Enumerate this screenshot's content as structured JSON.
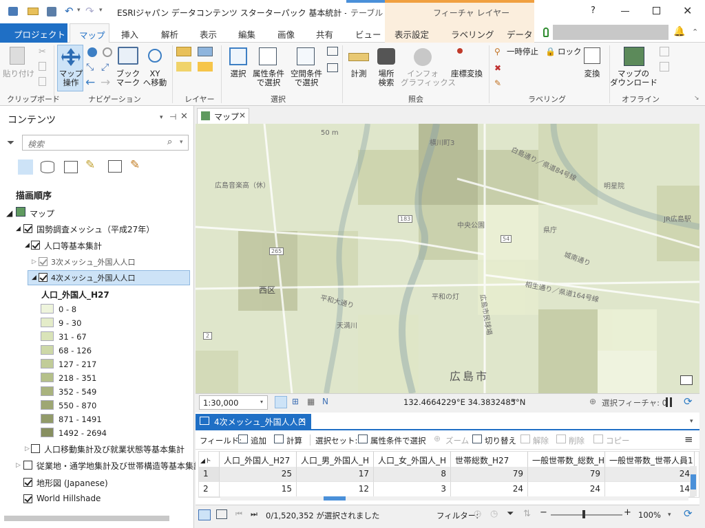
{
  "titlebar": {
    "title": "ESRIジャパン データコンテンツ スターターパック 基本統計 - 4次メッシュ...",
    "context_tab_table": "テーブル",
    "context_group": "フィーチャ レイヤー",
    "help": "?"
  },
  "ribbon_tabs": {
    "project": "プロジェクト",
    "map": "マップ",
    "insert": "挿入",
    "analysis": "解析",
    "view": "表示",
    "edit": "編集",
    "imagery": "画像",
    "share": "共有",
    "ctx_view": "ビュー",
    "appearance": "表示設定",
    "labeling": "ラベリング",
    "data": "データ"
  },
  "ribbon": {
    "clipboard": {
      "paste": "貼り付け",
      "group": "クリップボード"
    },
    "navigate": {
      "explore": "マップ\n操作",
      "bookmarks": "ブック\nマーク",
      "goto_xy": "XY\nへ移動",
      "group": "ナビゲーション"
    },
    "layer": {
      "group": "レイヤー"
    },
    "selection": {
      "select": "選択",
      "by_attr": "属性条件\nで選択",
      "by_loc": "空間条件\nで選択",
      "group": "選択"
    },
    "inquiry": {
      "measure": "計測",
      "locate": "場所\n検索",
      "infographics": "インフォ\nグラフィックス",
      "convert_coords": "座標変換",
      "group": "照会"
    },
    "labeling": {
      "pause": "一時停止",
      "lock": "ロック",
      "convert": "変換",
      "group": "ラベリング"
    },
    "offline": {
      "download": "マップの\nダウンロード",
      "group": "オフライン"
    }
  },
  "contents": {
    "title": "コンテンツ",
    "search_placeholder": "検索",
    "drawing_order": "描画順序",
    "map": "マップ",
    "layers": {
      "census_mesh": "国勢調査メッシュ（平成27年）",
      "pop_basic": "人口等基本集計",
      "mesh3": "3次メッシュ_外国人人口",
      "mesh4": "4次メッシュ_外国人人口",
      "field_name": "人口_外国人_H27",
      "movement": "人口移動集計及び就業状態等基本集計",
      "commuting": "従業地・通学地集計及び世帯構造等基本集計",
      "topo": "地形図 (Japanese)",
      "hillshade": "World Hillshade"
    },
    "legend": [
      {
        "label": "0 - 8",
        "color": "#eef4dc"
      },
      {
        "label": "9 - 30",
        "color": "#e4ecc9"
      },
      {
        "label": "31 - 67",
        "color": "#d9e3b8"
      },
      {
        "label": "68 - 126",
        "color": "#cdd8a8"
      },
      {
        "label": "127 - 217",
        "color": "#c1cc98"
      },
      {
        "label": "218 - 351",
        "color": "#b5c08a"
      },
      {
        "label": "352 - 549",
        "color": "#a9b37e"
      },
      {
        "label": "550 - 870",
        "color": "#9ea774"
      },
      {
        "label": "871 - 1491",
        "color": "#929b6a"
      },
      {
        "label": "1492 - 2694",
        "color": "#878f61"
      }
    ]
  },
  "map": {
    "tab": "マップ",
    "scale": "1:30,000",
    "coords": "132.4664229°E 34.3832485°N",
    "selected_features": "選択フィーチャ: 0",
    "labels": {
      "yokogawa": "横川町3",
      "hiroshima_shi": "広島市",
      "nishi_ku": "西区",
      "chuo_koen": "中央公園",
      "kencho": "県庁",
      "heiwa_odori": "平和大通り",
      "heiwa_odori2": "平和大通り",
      "meijiin": "明星院",
      "jr": "JR広島駅",
      "castle": "城南通り",
      "route183": "183",
      "route265": "265",
      "route54": "54",
      "route2": "2",
      "hiroshima_ongaku": "広島音楽高（休）",
      "tenma": "天満川",
      "heiwa_no_hi": "平和の灯",
      "m50": "50 m",
      "hakushima": "白島通り／県道84号線",
      "sagaraku": "相生通り／県道164号線",
      "kusunoki": "広島市民球場"
    }
  },
  "table": {
    "tab": "4次メッシュ_外国人人口",
    "field_label": "フィールド:",
    "add": "追加",
    "calculate": "計算",
    "selection_label": "選択セット:",
    "select_by_attr": "属性条件で選択",
    "zoom": "ズーム",
    "switch": "切り替え",
    "clear": "解除",
    "delete": "削除",
    "copy": "コピー",
    "columns": [
      "人口_外国人_H27",
      "人口_男_外国人_H",
      "人口_女_外国人_H",
      "世帯総数_H27",
      "一般世帯数_総数_H",
      "一般世帯数_世帯人員1"
    ],
    "rows": [
      {
        "idx": "1",
        "cells": [
          "25",
          "17",
          "8",
          "79",
          "79",
          "24"
        ]
      },
      {
        "idx": "2",
        "cells": [
          "15",
          "12",
          "3",
          "24",
          "24",
          "14"
        ]
      }
    ],
    "status": "0/1,520,352 が選択されました",
    "filter": "フィルター:",
    "zoom_level": "100%"
  }
}
